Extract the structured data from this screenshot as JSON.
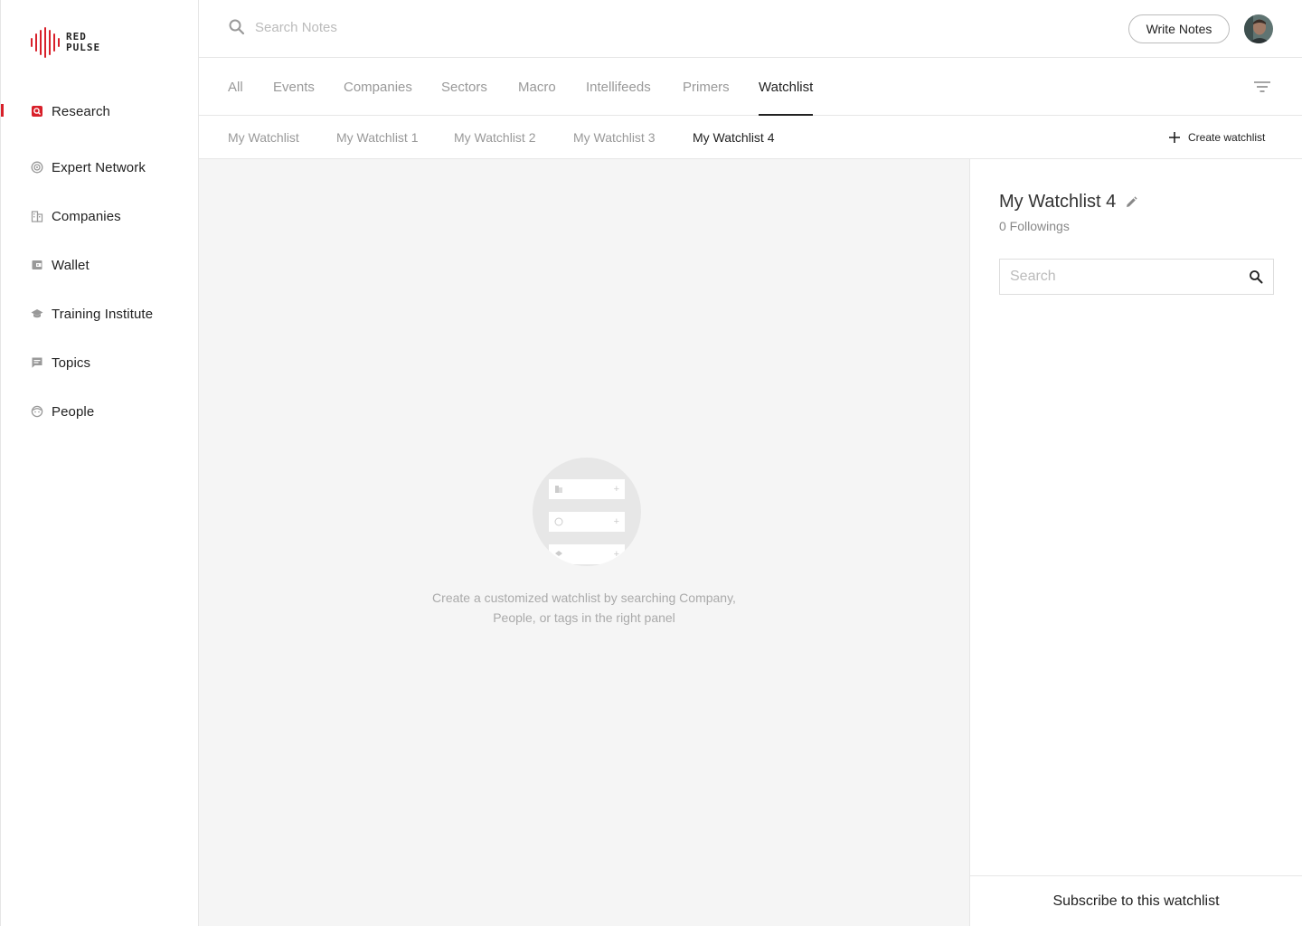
{
  "logo": {
    "line1": "RED",
    "line2": "PULSE",
    "brand_color": "#d8202a"
  },
  "sidebar": {
    "items": [
      {
        "label": "Research",
        "icon": "research-icon",
        "active": true
      },
      {
        "label": "Expert Network",
        "icon": "expert-network-icon"
      },
      {
        "label": "Companies",
        "icon": "building-icon"
      },
      {
        "label": "Wallet",
        "icon": "wallet-icon"
      },
      {
        "label": "Training Institute",
        "icon": "graduation-cap-icon"
      },
      {
        "label": "Topics",
        "icon": "chat-bubble-icon"
      },
      {
        "label": "People",
        "icon": "face-icon"
      }
    ]
  },
  "header": {
    "search_placeholder": "Search Notes",
    "write_notes_label": "Write Notes"
  },
  "tabs": [
    "All",
    "Events",
    "Companies",
    "Sectors",
    "Macro",
    "Intellifeeds",
    "Primers",
    "Watchlist"
  ],
  "active_tab": "Watchlist",
  "watchlists": {
    "items": [
      "My Watchlist",
      "My Watchlist 1",
      "My Watchlist 2",
      "My Watchlist 3",
      "My Watchlist 4"
    ],
    "active": "My Watchlist 4",
    "create_label": "Create watchlist"
  },
  "empty_state": {
    "line1": "Create a customized watchlist by searching Company,",
    "line2": "People, or tags in the right panel"
  },
  "panel": {
    "title": "My Watchlist 4",
    "followings": "0 Followings",
    "search_placeholder": "Search",
    "subscribe_label": "Subscribe to this watchlist"
  }
}
